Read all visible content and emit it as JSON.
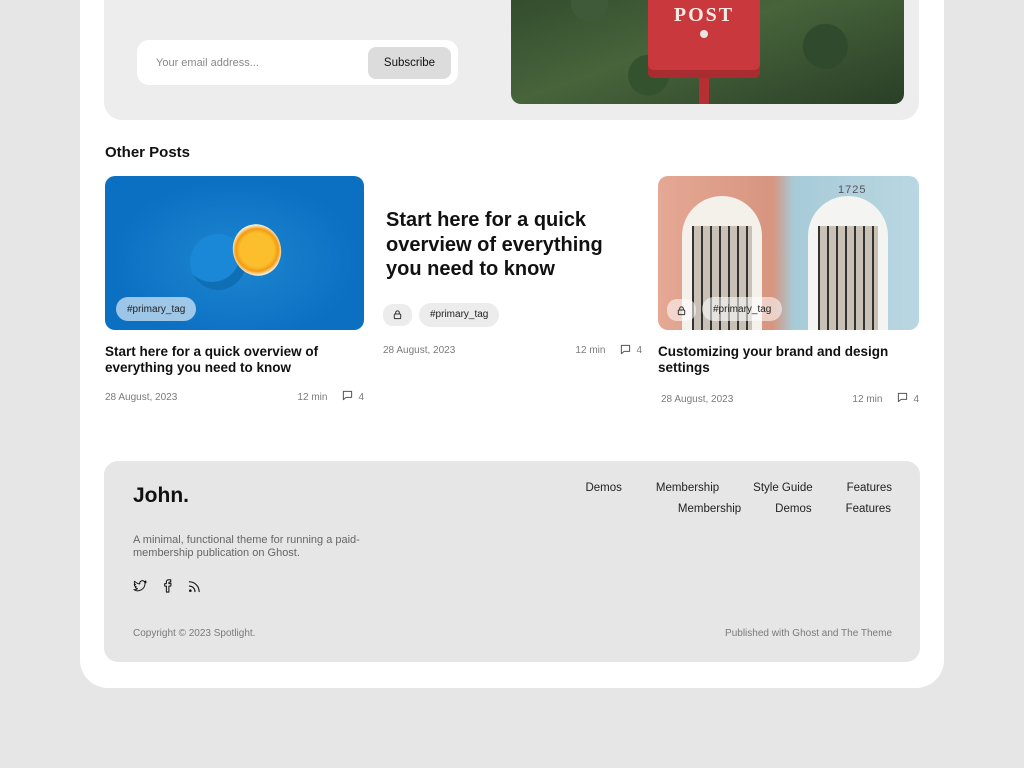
{
  "newsletter": {
    "email_placeholder": "Your email address...",
    "subscribe_label": "Subscribe",
    "mailbox_label": "POST"
  },
  "other_posts": {
    "title": "Other Posts",
    "cards": [
      {
        "tag": "#primary_tag",
        "title": "Start here for a quick overview of everything you need to know",
        "date": "28 August, 2023",
        "read_time": "12 min",
        "comments": "4"
      },
      {
        "tag": "#primary_tag",
        "title": "Start here for a quick overview of everything you need to know",
        "date": "28 August, 2023",
        "read_time": "12 min",
        "comments": "4"
      },
      {
        "tag": "#primary_tag",
        "title": "Customizing your brand and design settings",
        "date": "28 August, 2023",
        "read_time": "12 min",
        "comments": "4",
        "door_number": "1725"
      }
    ]
  },
  "footer": {
    "logo": "John.",
    "description": "A minimal, functional theme for running a paid-membership publication on Ghost.",
    "nav_row_1": [
      "Demos",
      "Membership",
      "Style Guide",
      "Features"
    ],
    "nav_row_2": [
      "Membership",
      "Demos",
      "Features"
    ],
    "copyright": "Copyright © 2023 Spotlight.",
    "published": "Published with Ghost and The Theme"
  },
  "colors": {
    "page_bg": "#e6e6e6",
    "card_bg": "#ffffff",
    "panel_bg": "#ededed",
    "accent_blue": "#0b6fc2",
    "mailbox_red": "#c9383c"
  },
  "icons": {
    "lock": "lock-icon",
    "comment": "comment-icon",
    "twitter": "twitter-icon",
    "facebook": "facebook-icon",
    "rss": "rss-icon"
  }
}
